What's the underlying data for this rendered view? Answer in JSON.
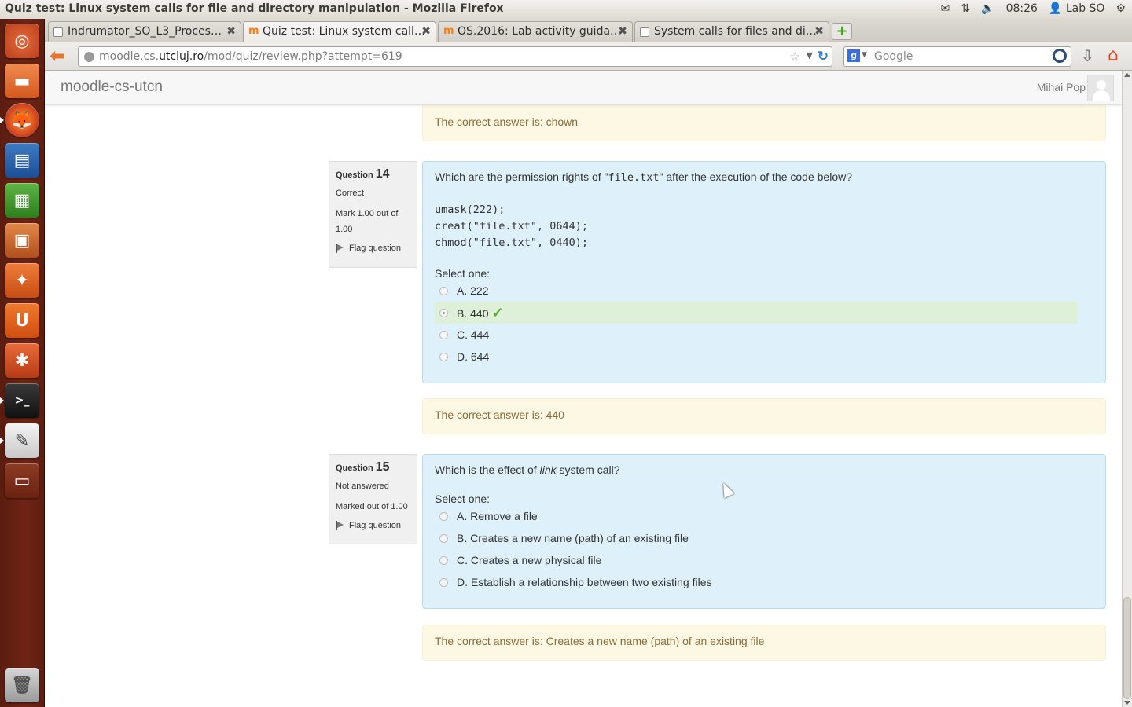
{
  "window": {
    "title": "Quiz test: Linux system calls for file and directory manipulation - Mozilla Firefox"
  },
  "tray": {
    "time": "08:26",
    "user": "Lab SO"
  },
  "tabs": [
    {
      "label": "Indrumator_SO_L3_Proces…",
      "active": false
    },
    {
      "label": "Quiz test: Linux system call…",
      "active": true
    },
    {
      "label": "OS.2016: Lab activity guida…",
      "active": false
    },
    {
      "label": "System calls for files and di…",
      "active": false
    }
  ],
  "url": {
    "prefix": "moodle.cs.",
    "host": "utcluj.ro",
    "path": "/mod/quiz/review.php?attempt=619"
  },
  "search": {
    "placeholder": "Google"
  },
  "site": {
    "brand": "moodle-cs-utcn",
    "user_name": "Mihai Pop"
  },
  "feedback_top": "The correct answer is: chown",
  "q14": {
    "label": "Question",
    "number": "14",
    "state": "Correct",
    "grade": "Mark 1.00 out of 1.00",
    "flag": "Flag question",
    "text_before": "Which are the permission rights of \"",
    "text_code": "file.txt",
    "text_after": "\" after the execution of the code below?",
    "code": "umask(222);\ncreat(\"file.txt\", 0644);\nchmod(\"file.txt\", 0440);",
    "prompt": "Select one:",
    "options": [
      "A. 222",
      "B. 440",
      "C. 444",
      "D. 644"
    ],
    "selected_index": 1,
    "feedback": "The correct answer is: 440"
  },
  "q15": {
    "label": "Question",
    "number": "15",
    "state": "Not answered",
    "grade": "Marked out of 1.00",
    "flag": "Flag question",
    "text_before": "Which is the effect of ",
    "text_em": "link",
    "text_after": " system call?",
    "prompt": "Select one:",
    "options": [
      "A. Remove a file",
      "B. Creates a new name (path) of an existing file",
      "C. Creates a new physical file",
      "D. Establish a relationship between two existing files"
    ],
    "feedback": "The correct answer is: Creates a new name (path) of an existing file"
  },
  "colors": {
    "question_bg": "#def0f9",
    "feedback_bg": "#fcf8e3",
    "correct_bg": "#dff0d8",
    "launcher": "#6e2415"
  }
}
